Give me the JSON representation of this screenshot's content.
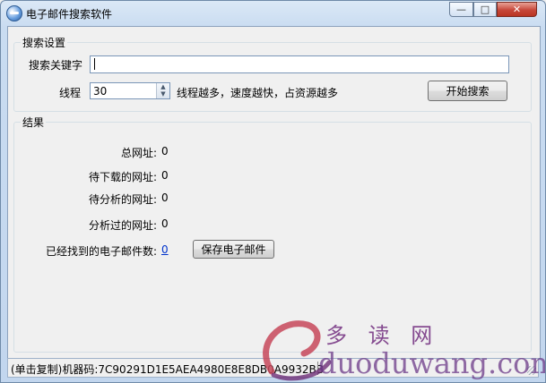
{
  "window": {
    "title": "电子邮件搜索软件",
    "controls": {
      "minimize": "—",
      "maximize": "□",
      "close": "✕"
    }
  },
  "search_settings": {
    "group_title": "搜索设置",
    "keyword_label": "搜索关键字",
    "keyword_value": "",
    "threads_label": "线程",
    "threads_value": "30",
    "threads_hint": "线程越多，速度越快，占资源越多",
    "start_button": "开始搜索"
  },
  "results": {
    "group_title": "结果",
    "total_label": "总网址:",
    "total_value": "0",
    "pending_download_label": "待下载的网址:",
    "pending_download_value": "0",
    "pending_analysis_label": "待分析的网址:",
    "pending_analysis_value": "0",
    "analyzed_label": "分析过的网址:",
    "analyzed_value": "0",
    "emails_found_label": "已经找到的电子邮件数:",
    "emails_found_value": "0",
    "save_button": "保存电子邮件"
  },
  "statusbar": {
    "machine_code": "(单击复制)机器码:7C90291D1E5AEA4980E8E8DB0A9932BB"
  },
  "watermark": {
    "text_cn": "多 读 网",
    "text_en": "duoduwang.com"
  }
}
